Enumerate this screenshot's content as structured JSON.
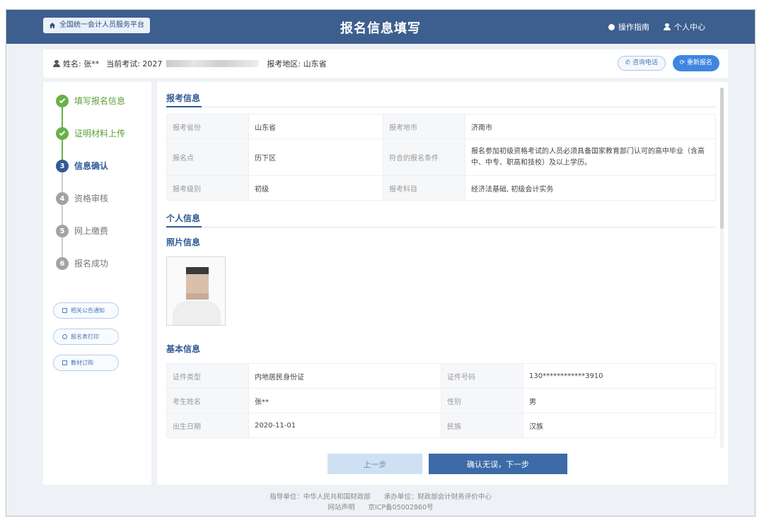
{
  "topbar": {
    "platform_label": "全国统一会计人员服务平台",
    "title": "报名信息填写",
    "guide_label": "操作指南",
    "user_center_label": "个人中心"
  },
  "infobar": {
    "name_label": "姓名: 张**",
    "exam_label": "当前考试: 2027",
    "region_label": "报考地区: 山东省",
    "hotline_label": "咨询电话",
    "reregister_label": "重新报名"
  },
  "steps": [
    {
      "num": "1",
      "label": "填写报名信息",
      "state": "done"
    },
    {
      "num": "2",
      "label": "证明材料上传",
      "state": "done"
    },
    {
      "num": "3",
      "label": "信息确认",
      "state": "active"
    },
    {
      "num": "4",
      "label": "资格审核",
      "state": "todo"
    },
    {
      "num": "5",
      "label": "网上缴费",
      "state": "todo"
    },
    {
      "num": "6",
      "label": "报名成功",
      "state": "todo"
    }
  ],
  "side_buttons": {
    "notice": "相关公告通知",
    "print": "报名表打印",
    "textbook": "教材订购"
  },
  "exam_info": {
    "section_title": "报考信息",
    "province_k": "报考省份",
    "province_v": "山东省",
    "city_k": "报考地市",
    "city_v": "济南市",
    "site_k": "报名点",
    "site_v": "历下区",
    "cond_k": "符合的报名条件",
    "cond_v": "报名参加初级资格考试的人员必须具备国家教育部门认可的高中毕业（含高中、中专、职高和技校）及以上学历。",
    "level_k": "报考级别",
    "level_v": "初级",
    "subject_k": "报考科目",
    "subject_v": "经济法基础, 初级会计实务"
  },
  "personal": {
    "section_title": "个人信息",
    "photo_title": "照片信息",
    "basic_title": "基本信息",
    "idtype_k": "证件类型",
    "idtype_v": "内地居民身份证",
    "idno_k": "证件号码",
    "idno_v": "130************3910",
    "name_k": "考生姓名",
    "name_v": "张**",
    "gender_k": "性别",
    "gender_v": "男",
    "birth_k": "出生日期",
    "birth_v": "2020-11-01",
    "ethnic_k": "民族",
    "ethnic_v": "汉族"
  },
  "actions": {
    "prev": "上一步",
    "next": "确认无误，下一步"
  },
  "footer": {
    "guide": "指导单位：中华人民共和国财政部",
    "host": "承办单位：财政部会计财务评价中心",
    "statement": "网站声明",
    "icp": "京ICP备05002860号"
  }
}
